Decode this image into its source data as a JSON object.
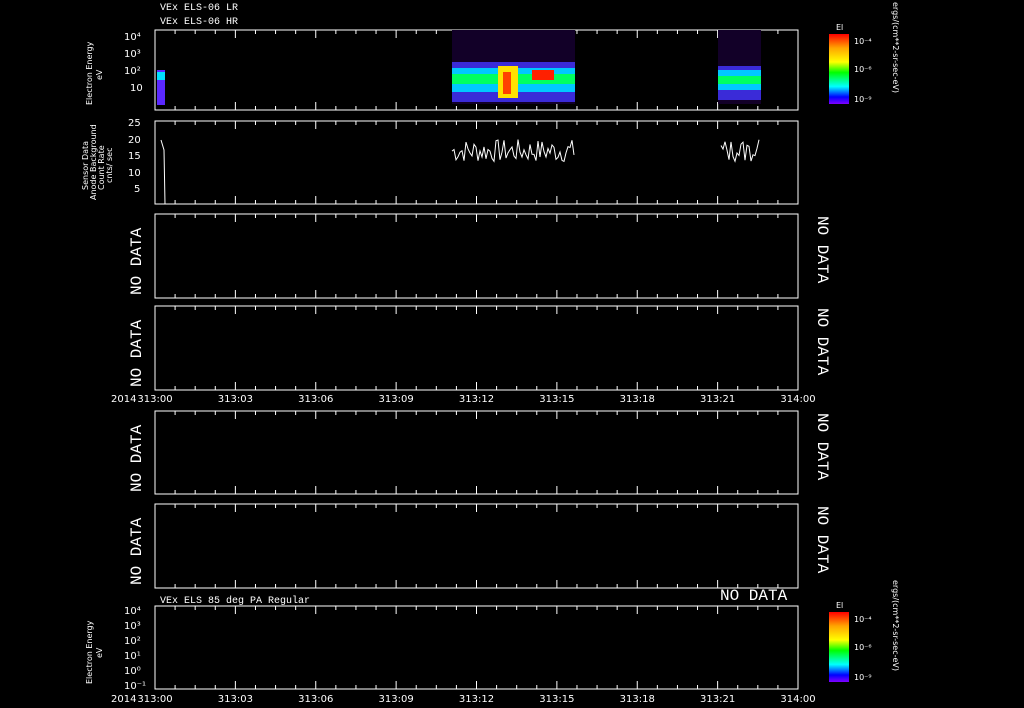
{
  "header": {
    "line1": "VEx ELS-06 LR",
    "line2": "VEx ELS-06 HR"
  },
  "panel1": {
    "ylabel": "Electron Energy",
    "yunit": "eV",
    "ticks": [
      "10⁴",
      "10³",
      "10²",
      "10"
    ],
    "colorbar": {
      "title": "El",
      "unit": "ergs/(cm**2-sr-sec-eV)",
      "labels": [
        "10⁻⁴",
        "10⁻⁶",
        "10⁻⁹"
      ]
    }
  },
  "panel2": {
    "ylabel_lines": [
      "Sensor Data",
      "Anode Background",
      "Count Rate",
      "cnts/ sec"
    ],
    "ticks": [
      "25",
      "20",
      "15",
      "10",
      "5"
    ]
  },
  "nodata_label": "NO DATA",
  "time_axis": {
    "year": "2014",
    "labels": [
      "313:00",
      "313:03",
      "313:06",
      "313:09",
      "313:12",
      "313:15",
      "313:18",
      "313:21",
      "314:00"
    ]
  },
  "panel7": {
    "title": "VEx ELS 85 deg PA Regular",
    "ylabel": "Electron Energy",
    "yunit": "eV",
    "ticks": [
      "10⁴",
      "10³",
      "10²",
      "10¹",
      "10⁰",
      "10⁻¹"
    ],
    "nodata": "NO DATA",
    "colorbar": {
      "title": "El",
      "unit": "ergs/(cm**2-sr-sec-eV)",
      "labels": [
        "10⁻⁴",
        "10⁻⁶",
        "10⁻⁹"
      ]
    }
  },
  "chart_data": [
    {
      "type": "heatmap",
      "title": "VEx ELS-06 LR / VEx ELS-06 HR",
      "ylabel": "Electron Energy eV",
      "yscale": "log",
      "data_intervals": [
        [
          "313:11",
          "313:15"
        ],
        [
          "313:21",
          "313:22"
        ]
      ]
    },
    {
      "type": "line",
      "ylabel": "Sensor Data Anode Background Count Rate cnts/ sec",
      "ylim": [
        0,
        25
      ],
      "series": [
        {
          "x_range": [
            "313:11",
            "313:15"
          ],
          "mean": 16
        },
        {
          "x_range": [
            "313:21",
            "313:22"
          ],
          "mean": 16
        }
      ]
    }
  ]
}
